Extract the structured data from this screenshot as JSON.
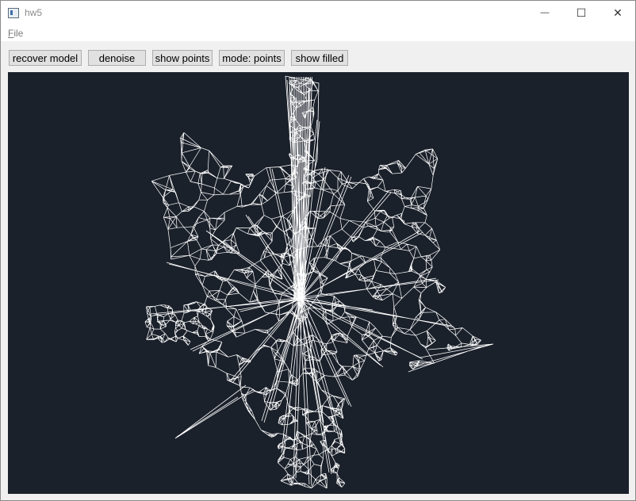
{
  "window": {
    "title": "hw5",
    "minimize_glyph": "—",
    "maximize_glyph": "☐",
    "close_glyph": "✕"
  },
  "menu": {
    "file_accel": "F",
    "file_rest": "ile"
  },
  "toolbar": {
    "recover_model": "recover model",
    "denoise": "denoise",
    "show_points": "show points",
    "mode": "mode: points",
    "show_filled": "show filled"
  },
  "colors": {
    "viewport_bg": "#1b212b",
    "mesh": "#ffffff"
  },
  "icons": [
    "app-icon",
    "minimize-icon",
    "maximize-icon",
    "close-icon"
  ]
}
